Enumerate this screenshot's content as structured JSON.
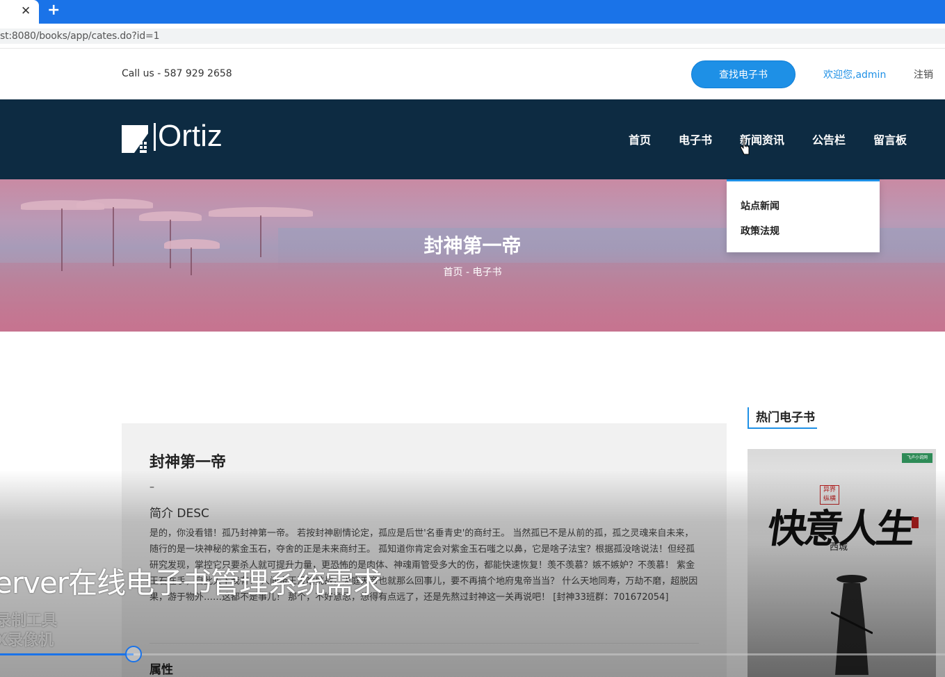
{
  "browser": {
    "close_glyph": "✕",
    "new_tab_glyph": "+",
    "url": "st:8080/books/app/cates.do?id=1"
  },
  "topbar": {
    "call_us": "Call us - 587 929 2658",
    "find_button": "查找电子书",
    "welcome": "欢迎您,admin",
    "logout": "注销"
  },
  "nav": {
    "logo_text": "Ortiz",
    "items": [
      "首页",
      "电子书",
      "新闻资讯",
      "公告栏",
      "留言板"
    ],
    "dropdown": [
      "站点新闻",
      "政策法规"
    ]
  },
  "banner": {
    "title": "封神第一帝",
    "breadcrumb": "首页 -  电子书"
  },
  "book": {
    "title": "封神第一帝",
    "dash": "–",
    "desc_heading": "简介 DESC",
    "desc_body": "是的，你没看错！孤乃封神第一帝。 若按封神剧情论定，孤应是后世'名垂青史'的商纣王。 当然孤已不是从前的孤，孤之灵魂来自未来，随行的是一块神秘的紫金玉石，夺舍的正是未来商纣王。 孤知道你肯定会对紫金玉石嗤之以鼻，它是啥子法宝？根据孤没啥说法！但经孤研究发现，掌控它只要杀人就可提升力量，更恐怖的是肉体、神魂甭管受多大的伤，都能快速恢复！羡不羡慕？嫉不嫉妒？不羡慕！ 紫金玉石在手，自此天下我有！ 人间帝王没啥挑战，天庭天帝也就那么回事儿，要不再搞个地府鬼帝当当？ 什么天地同寿，万劫不磨，超脱因果，游于物外……这都不是事儿！ 那个，不好意思，想得有点远了，还是先熬过封神这一关再说吧！ [封神33班群：701672054]",
    "attr_heading": "属性"
  },
  "sidebar": {
    "heading": "热门电子书",
    "cover_title": "快意人生",
    "cover_author": "西城",
    "cover_stamp": "异界纵横",
    "cover_badge": "飞卢小说网"
  },
  "video": {
    "caption": "erver在线电子书管理系统需求",
    "watermark_line1": "录制工具",
    "watermark_line2": "X录像机",
    "progress": 0.141
  },
  "colors": {
    "tabbar": "#1a73e8",
    "nav_bg": "#0d2b42",
    "accent": "#1e90e6"
  }
}
